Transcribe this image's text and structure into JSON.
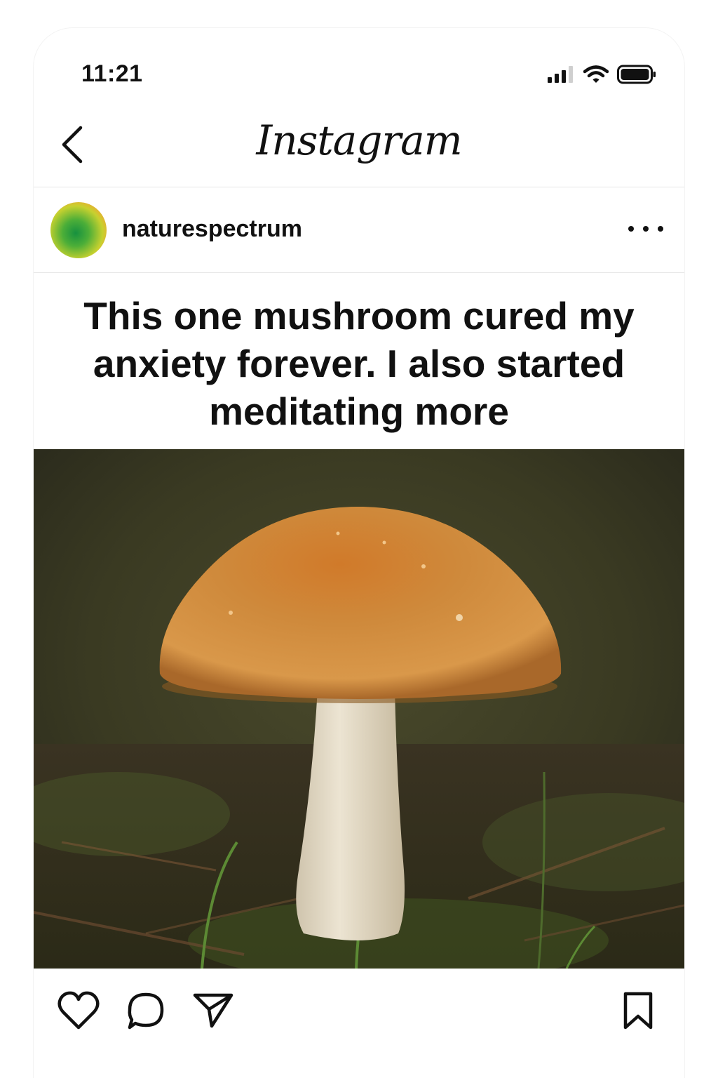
{
  "status_bar": {
    "time": "11:21",
    "icons": [
      "signal-icon",
      "wifi-icon",
      "battery-icon"
    ]
  },
  "header": {
    "title": "Instagram",
    "back_icon": "chevron-left-icon"
  },
  "post": {
    "username": "naturespectrum",
    "avatar": "avatar-icon",
    "more_icon": "more-horizontal-icon",
    "caption": "This one mushroom cured my anxiety forever. I also started meditating more",
    "image": "mushroom-photo"
  },
  "actions": {
    "icons": [
      "heart-icon",
      "comment-icon",
      "share-icon",
      "bookmark-icon"
    ]
  },
  "colors": {
    "text": "#111111",
    "divider": "#e6e6e6",
    "avatar_inner": "#17913f",
    "avatar_ring": "#e9503f",
    "mushroom_cap": "#c97a2d",
    "mushroom_stem": "#e9e0cc"
  }
}
